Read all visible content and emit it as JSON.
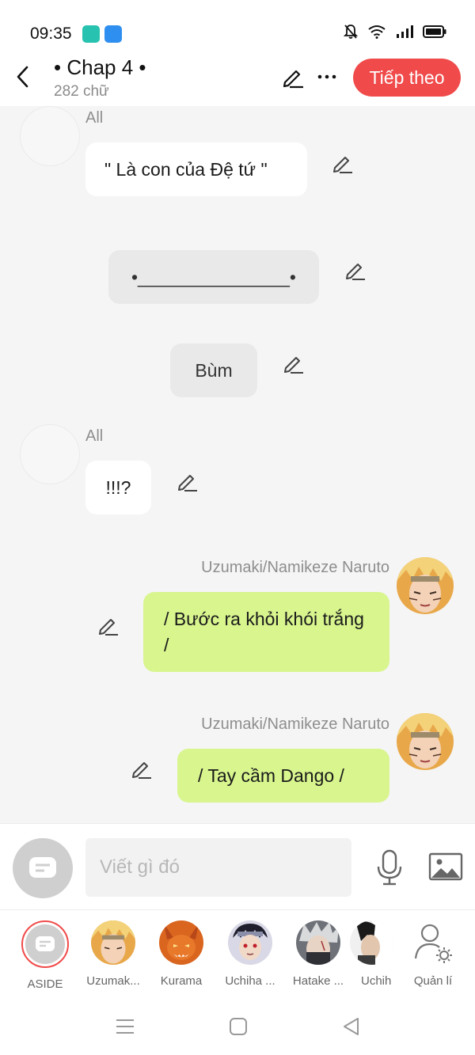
{
  "status_bar": {
    "time": "09:35",
    "icons": [
      "app-notification-icon",
      "app-hotspot-icon",
      "bell-muted-icon",
      "wifi-icon",
      "signal-icon",
      "battery-icon"
    ]
  },
  "header": {
    "title": "• Chap 4 •",
    "subtitle": "282 chữ",
    "next_label": "Tiếp theo",
    "accent_color": "#f04a4a"
  },
  "messages": [
    {
      "type": "left",
      "sender": "All",
      "text": "\" Là con của Đệ tứ \""
    },
    {
      "type": "narration",
      "text": "•_______________•"
    },
    {
      "type": "narration",
      "text": "Bùm"
    },
    {
      "type": "left",
      "sender": "All",
      "text": "!!!?"
    },
    {
      "type": "right",
      "sender": "Uzumaki/Namikeze Naruto",
      "text": "/ Bước ra khỏi khói trắng /",
      "bubble_color": "#d8f58e"
    },
    {
      "type": "right",
      "sender": "Uzumaki/Namikeze Naruto",
      "text": "/ Tay cầm Dango /",
      "bubble_color": "#d8f58e"
    }
  ],
  "input": {
    "placeholder": "Viết gì đó"
  },
  "characters": [
    {
      "label": "ASIDE",
      "icon": "chat-bubble-icon"
    },
    {
      "label": "Uzumak...",
      "icon": "naruto-avatar"
    },
    {
      "label": "Kurama",
      "icon": "kurama-avatar"
    },
    {
      "label": "Uchiha ...",
      "icon": "uchiha-avatar"
    },
    {
      "label": "Hatake ...",
      "icon": "hatake-avatar"
    },
    {
      "label": "Uchih",
      "icon": "uchiha-avatar-2"
    },
    {
      "label": "Quản lí",
      "icon": "user-settings-icon"
    }
  ]
}
